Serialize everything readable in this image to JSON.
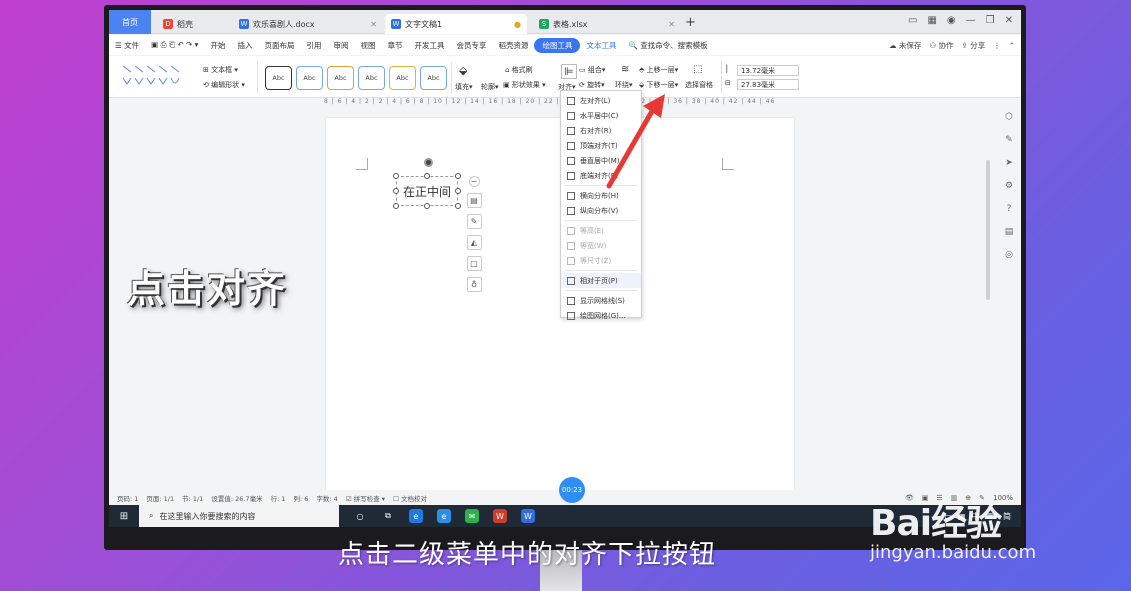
{
  "tabs": {
    "home": "首页",
    "dao": "稻壳",
    "docx": "欢乐喜剧人.docx",
    "active": "文字文稿1",
    "xlsx": "表格.xlsx"
  },
  "menu": {
    "file": "文件",
    "items": [
      "开始",
      "插入",
      "页面布局",
      "引用",
      "审阅",
      "视图",
      "章节",
      "开发工具",
      "会员专享",
      "稻壳资源"
    ],
    "drawing_tool": "绘图工具",
    "text_tool": "文本工具",
    "search": "查找命令、搜索模板",
    "unsaved": "未保存",
    "collab": "协作",
    "share": "分享"
  },
  "ribbon": {
    "textbox": "文本框",
    "edit_shape": "编辑形状",
    "style_label": "Abc",
    "fill": "填充",
    "outline": "轮廓",
    "format_painter": "格式刷",
    "shape_effect": "形状效果",
    "align": "对齐",
    "group": "组合",
    "rotate": "旋转",
    "wrap": "环绕",
    "bring_forward": "上移一层",
    "send_backward": "下移一层",
    "selection_pane": "选择窗格",
    "height": "13.72毫米",
    "width": "27.83毫米"
  },
  "ruler": "8 | 6 | 4 | 2 | 2 | 4 | 6 | 8 | 10 | 12 | 14 | 16 | 18 | 20 | 22 | 24 | 26 | 28 | 30 | 32 | 34 | 36 | 38 | 40 | 42 | 44 | 46",
  "document": {
    "textbox_text": "在正中间"
  },
  "align_menu": [
    {
      "label": "左对齐(L)",
      "disabled": false
    },
    {
      "label": "水平居中(C)",
      "disabled": false
    },
    {
      "label": "右对齐(R)",
      "disabled": false
    },
    {
      "label": "顶端对齐(T)",
      "disabled": false
    },
    {
      "label": "垂直居中(M)",
      "disabled": false
    },
    {
      "label": "底端对齐(B)",
      "disabled": false
    },
    {
      "label": "横向分布(H)",
      "disabled": false
    },
    {
      "label": "纵向分布(V)",
      "disabled": false
    },
    {
      "label": "等高(E)",
      "disabled": true
    },
    {
      "label": "等宽(W)",
      "disabled": true
    },
    {
      "label": "等尺寸(Z)",
      "disabled": true
    },
    {
      "label": "相对于页(P)",
      "disabled": false
    },
    {
      "label": "显示网格线(S)",
      "disabled": false
    },
    {
      "label": "绘图网格(G)...",
      "disabled": false
    }
  ],
  "status": {
    "page": "页码: 1",
    "pages": "页面: 1/1",
    "section": "节: 1/1",
    "setting": "设置值: 26.7毫米",
    "row": "行: 1",
    "col": "列: 6",
    "words": "字数: 4",
    "spell": "拼写检查",
    "proof": "文档校对",
    "zoom": "100%"
  },
  "timer": "00:23",
  "taskbar": {
    "search_placeholder": "在这里输入你要搜索的内容",
    "ime": "中",
    "ime2": "简"
  },
  "overlay_text": "点击对齐",
  "caption": "点击二级菜单中的对齐下拉按钮",
  "watermark": {
    "logo": "Bai经验",
    "url": "jingyan.baidu.com"
  },
  "colors": {
    "accent": "#3a76f0",
    "arrow": "#e53935",
    "timer": "#2f8df5"
  }
}
